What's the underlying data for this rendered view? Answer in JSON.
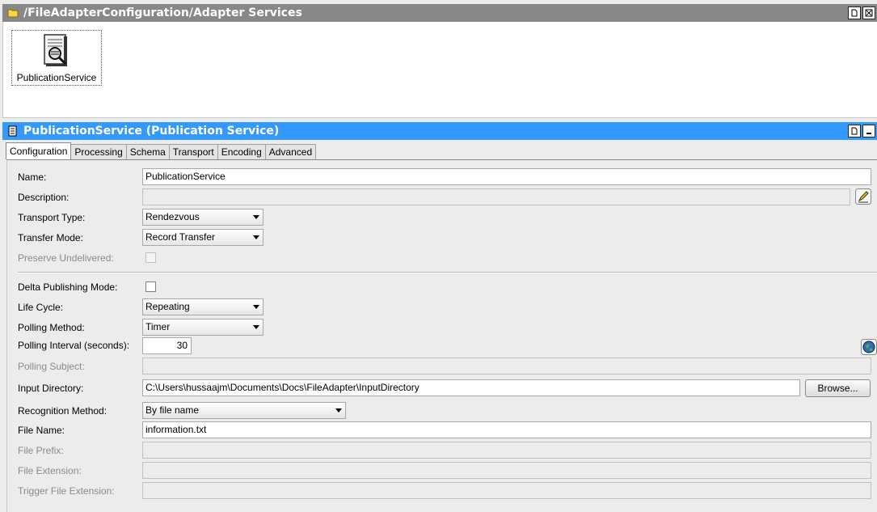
{
  "path_bar": {
    "title": "/FileAdapterConfiguration/Adapter Services",
    "folder_icon": "folder-icon",
    "controls": [
      "document-icon",
      "close-icon"
    ]
  },
  "services_area": {
    "item_label": "PublicationService",
    "item_icon": "publication-service-icon"
  },
  "service_bar": {
    "title": "PublicationService (Publication Service)",
    "icon": "service-icon",
    "controls": [
      "document-icon",
      "minimize-icon"
    ]
  },
  "tabs": [
    {
      "label": "Configuration",
      "active": true
    },
    {
      "label": "Processing",
      "active": false
    },
    {
      "label": "Schema",
      "active": false
    },
    {
      "label": "Transport",
      "active": false
    },
    {
      "label": "Encoding",
      "active": false
    },
    {
      "label": "Advanced",
      "active": false
    }
  ],
  "form": {
    "name": {
      "label": "Name:",
      "value": "PublicationService"
    },
    "description": {
      "label": "Description:",
      "value": "",
      "edit_icon": "pencil-icon"
    },
    "transport_type": {
      "label": "Transport Type:",
      "value": "Rendezvous"
    },
    "transfer_mode": {
      "label": "Transfer Mode:",
      "value": "Record Transfer"
    },
    "preserve_undelivered": {
      "label": "Preserve Undelivered:",
      "checked": false,
      "disabled": true
    },
    "delta_publishing": {
      "label": "Delta Publishing Mode:",
      "checked": false
    },
    "life_cycle": {
      "label": "Life Cycle:",
      "value": "Repeating"
    },
    "polling_method": {
      "label": "Polling Method:",
      "value": "Timer"
    },
    "polling_interval": {
      "label": "Polling Interval (seconds):",
      "value": "30",
      "globe_icon": "globe-icon"
    },
    "polling_subject": {
      "label": "Polling Subject:",
      "value": ""
    },
    "input_directory": {
      "label": "Input Directory:",
      "value": "C:\\Users\\hussaajm\\Documents\\Docs\\FileAdapter\\InputDirectory",
      "browse_label": "Browse..."
    },
    "recognition_method": {
      "label": "Recognition Method:",
      "value": "By file name"
    },
    "file_name": {
      "label": "File Name:",
      "value": "information.txt"
    },
    "file_prefix": {
      "label": "File Prefix:",
      "value": ""
    },
    "file_extension": {
      "label": "File Extension:",
      "value": ""
    },
    "trigger_file_extension": {
      "label": "Trigger File Extension:",
      "value": ""
    }
  },
  "colors": {
    "path_bar": "#888888",
    "service_bar": "#3399ff",
    "panel_background": "#ececec"
  }
}
